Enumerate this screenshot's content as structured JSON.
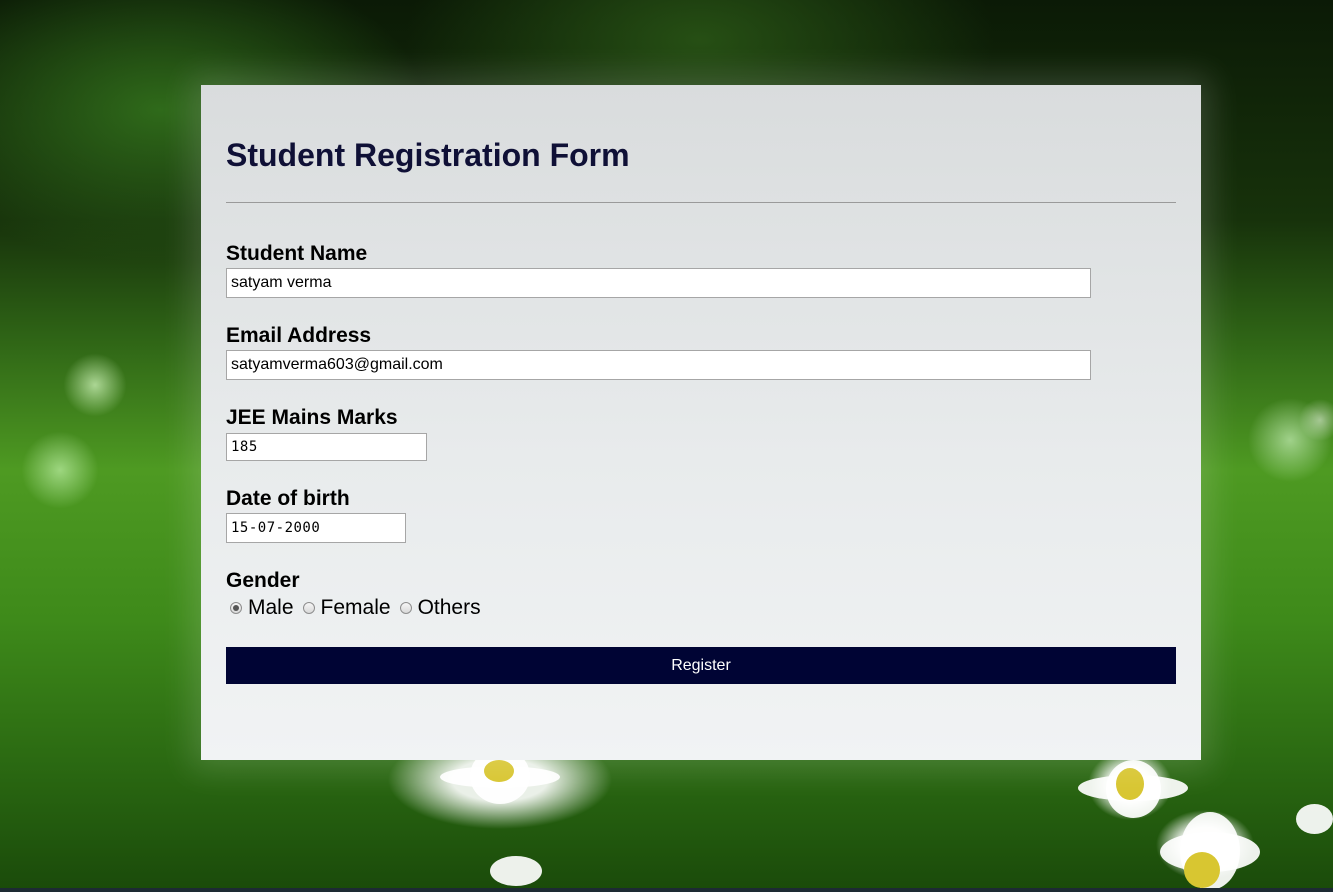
{
  "form": {
    "title": "Student Registration Form",
    "fields": {
      "name": {
        "label": "Student Name",
        "value": "satyam verma"
      },
      "email": {
        "label": "Email Address",
        "value": "satyamverma603@gmail.com"
      },
      "marks": {
        "label": "JEE Mains Marks",
        "value": "185"
      },
      "dob": {
        "label": "Date of birth",
        "value": "15-07-2000"
      }
    },
    "gender": {
      "label": "Gender",
      "options": [
        "Male",
        "Female",
        "Others"
      ],
      "selected": "Male"
    },
    "submit_label": "Register",
    "accent_color": "#000434",
    "title_color": "#0f1036"
  }
}
